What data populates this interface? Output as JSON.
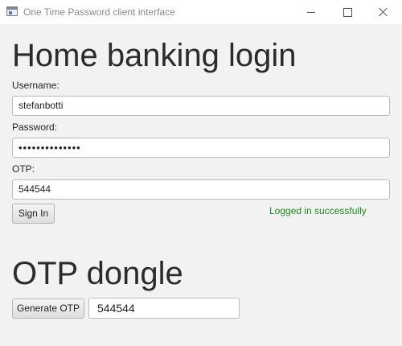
{
  "window": {
    "title": "One Time Password client interface",
    "icon": "app-window-icon",
    "controls": [
      "minimize-icon",
      "maximize-icon",
      "close-icon"
    ]
  },
  "login": {
    "heading": "Home banking login",
    "username_label": "Username:",
    "username_value": "stefanbotti",
    "password_label": "Password:",
    "password_value": "••••••••••••••",
    "otp_label": "OTP:",
    "otp_value": "544544",
    "signin_label": "Sign In",
    "status_text": "Logged in successfully",
    "status_color": "#1a8a1a"
  },
  "dongle": {
    "heading": "OTP dongle",
    "generate_label": "Generate OTP",
    "otp_value": "544544"
  }
}
